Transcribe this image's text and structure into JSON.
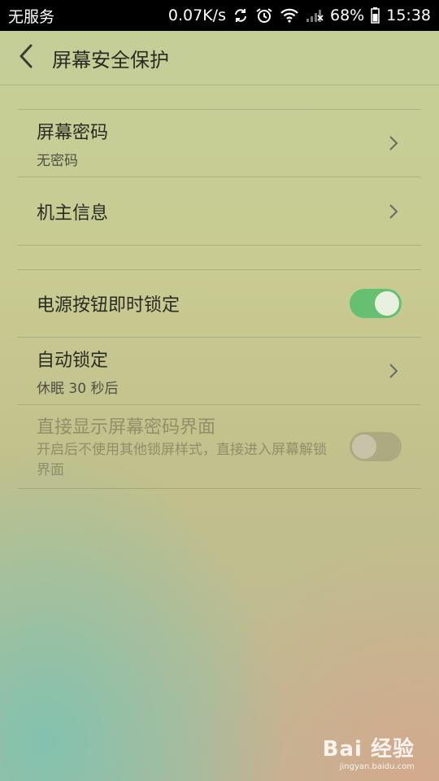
{
  "status_bar": {
    "carrier": "无服务",
    "speed": "0.07K/s",
    "battery": "68%",
    "time": "15:38",
    "icons": [
      "sync-icon",
      "alarm-icon",
      "wifi-icon",
      "signal-icon"
    ]
  },
  "header": {
    "title": "屏幕安全保护",
    "back_icon": "back-arrow-icon"
  },
  "group1": {
    "screen_password": {
      "title": "屏幕密码",
      "subtitle": "无密码"
    },
    "owner_info": {
      "title": "机主信息"
    }
  },
  "group2": {
    "power_lock": {
      "title": "电源按钮即时锁定",
      "enabled": true
    },
    "auto_lock": {
      "title": "自动锁定",
      "subtitle": "休眠 30 秒后"
    },
    "direct_password": {
      "title": "直接显示屏幕密码界面",
      "subtitle": "开启后不使用其他锁屏样式，直接进入屏幕解锁界面",
      "enabled": false,
      "disabled": true
    }
  },
  "colors": {
    "toggle_on": "#67c072",
    "status_bar_bg": "#000000"
  },
  "watermark": {
    "brand": "Bai 经验",
    "url": "jingyan.baidu.com"
  }
}
